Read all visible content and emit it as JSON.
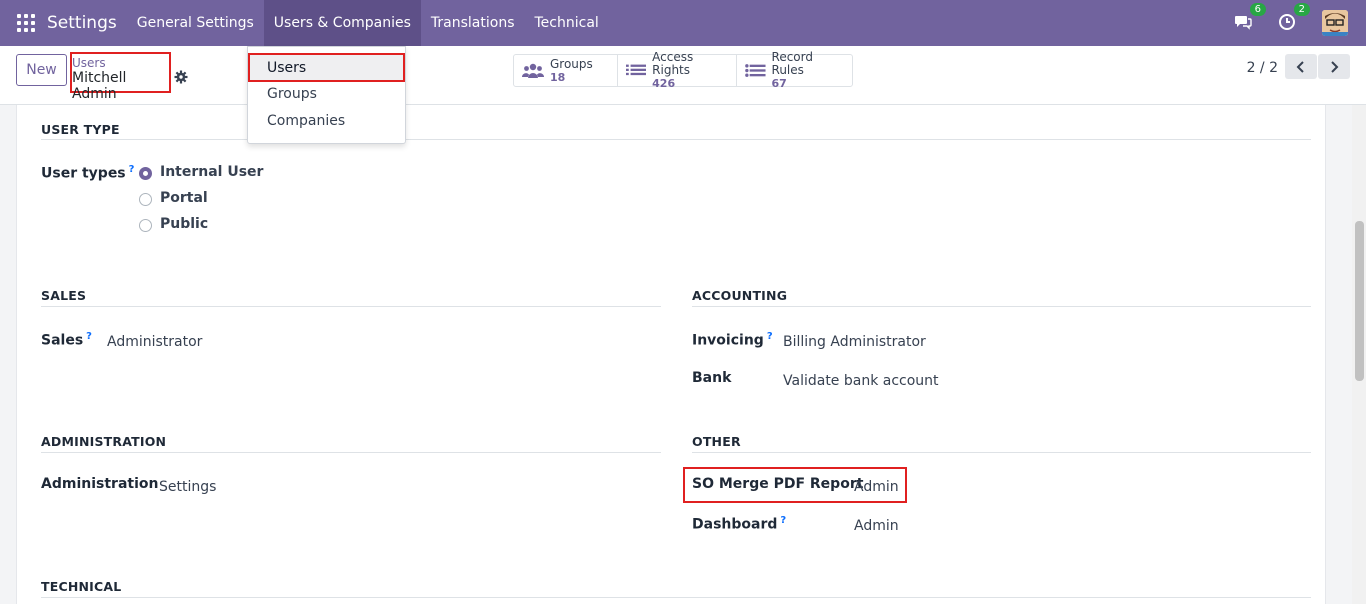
{
  "navbar": {
    "brand": "Settings",
    "menu": [
      "General Settings",
      "Users & Companies",
      "Translations",
      "Technical"
    ],
    "messages_count": "6",
    "activities_count": "2"
  },
  "control": {
    "new_label": "New",
    "breadcrumb_parent": "Users",
    "breadcrumb_current": "Mitchell Admin",
    "smart_buttons": [
      {
        "label": "Groups",
        "value": "18",
        "icon": "users-icon"
      },
      {
        "label": "Access Rights",
        "value": "426",
        "icon": "list-icon"
      },
      {
        "label": "Record Rules",
        "value": "67",
        "icon": "list-icon"
      }
    ],
    "pager": "2 / 2"
  },
  "dropdown": {
    "items": [
      "Users",
      "Groups",
      "Companies"
    ]
  },
  "form": {
    "user_type": {
      "title": "USER TYPE",
      "label": "User types",
      "options": [
        "Internal User",
        "Portal",
        "Public"
      ]
    },
    "sales": {
      "title": "SALES",
      "label": "Sales",
      "value": "Administrator"
    },
    "accounting": {
      "title": "ACCOUNTING",
      "invoicing_label": "Invoicing",
      "invoicing_value": "Billing Administrator",
      "bank_label": "Bank",
      "bank_value": "Validate bank account"
    },
    "administration": {
      "title": "ADMINISTRATION",
      "label": "Administration",
      "value": "Settings"
    },
    "other": {
      "title": "OTHER",
      "so_merge_label": "SO Merge PDF Report",
      "so_merge_value": "Admin",
      "dashboard_label": "Dashboard",
      "dashboard_value": "Admin"
    },
    "technical": {
      "title": "TECHNICAL"
    },
    "help_mark": "?"
  },
  "colors": {
    "brand": "#71639e",
    "highlight": "#e02020",
    "badge": "#28a745"
  }
}
